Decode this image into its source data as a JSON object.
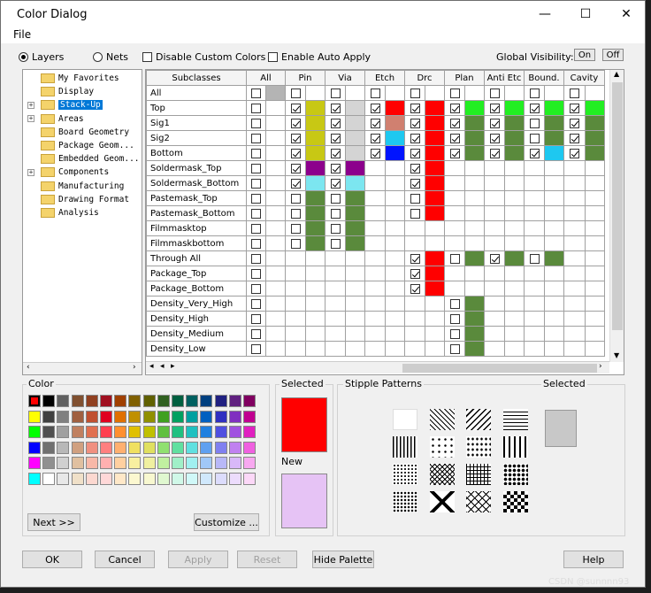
{
  "window": {
    "title": "Color Dialog",
    "minimize": "—",
    "maximize": "☐",
    "close": "✕"
  },
  "menu": {
    "file": "File"
  },
  "options": {
    "layers_label": "Layers",
    "nets_label": "Nets",
    "disable_custom_label": "Disable Custom Colors",
    "auto_apply_label": "Enable Auto Apply",
    "global_visibility_label": "Global Visibility:",
    "on_label": "On",
    "off_label": "Off"
  },
  "tree": {
    "items": [
      {
        "label": "My Favorites",
        "expander": false,
        "selected": false
      },
      {
        "label": "Display",
        "expander": false,
        "selected": false
      },
      {
        "label": "Stack-Up",
        "expander": true,
        "selected": true
      },
      {
        "label": "Areas",
        "expander": true,
        "selected": false
      },
      {
        "label": "Board Geometry",
        "expander": false,
        "selected": false
      },
      {
        "label": "Package Geom...",
        "expander": false,
        "selected": false
      },
      {
        "label": "Embedded Geom...",
        "expander": false,
        "selected": false
      },
      {
        "label": "Components",
        "expander": true,
        "selected": false
      },
      {
        "label": "Manufacturing",
        "expander": false,
        "selected": false
      },
      {
        "label": "Drawing Format",
        "expander": false,
        "selected": false
      },
      {
        "label": "Analysis",
        "expander": false,
        "selected": false
      }
    ]
  },
  "grid": {
    "name_header": "Subclasses",
    "columns": [
      "All",
      "Pin",
      "Via",
      "Etch",
      "Drc",
      "Plan",
      "Anti Etc",
      "Bound.",
      "Cavity"
    ],
    "rows": [
      {
        "name": "All",
        "cells": [
          [
            "c",
            "#b4b4b4"
          ],
          [
            "c",
            ""
          ],
          [
            "c",
            ""
          ],
          [
            "c",
            ""
          ],
          [
            "c",
            ""
          ],
          [
            "c",
            ""
          ],
          [
            "c",
            ""
          ],
          [
            "c",
            ""
          ],
          [
            "c",
            ""
          ]
        ]
      },
      {
        "name": "Top",
        "cells": [
          [
            "c",
            ""
          ],
          [
            "k",
            "#c8c814"
          ],
          [
            "k",
            "#d4d4d4"
          ],
          [
            "k",
            "#ff0000"
          ],
          [
            "k",
            "#ff0000"
          ],
          [
            "k",
            "#22ee22"
          ],
          [
            "k",
            "#22ee22"
          ],
          [
            "k",
            "#22ee22"
          ],
          [
            "k",
            "#22ee22"
          ]
        ]
      },
      {
        "name": "Sig1",
        "cells": [
          [
            "c",
            ""
          ],
          [
            "k",
            "#c8c814"
          ],
          [
            "k",
            "#d4d4d4"
          ],
          [
            "k",
            "#d08070"
          ],
          [
            "k",
            "#ff0000"
          ],
          [
            "k",
            "#5a8a3c"
          ],
          [
            "k",
            "#5a8a3c"
          ],
          [
            "c",
            "#5a8a3c"
          ],
          [
            "k",
            "#5a8a3c"
          ]
        ]
      },
      {
        "name": "Sig2",
        "cells": [
          [
            "c",
            ""
          ],
          [
            "k",
            "#c8c814"
          ],
          [
            "k",
            "#d4d4d4"
          ],
          [
            "k",
            "#1ec8f0"
          ],
          [
            "k",
            "#ff0000"
          ],
          [
            "k",
            "#5a8a3c"
          ],
          [
            "k",
            "#5a8a3c"
          ],
          [
            "c",
            "#5a8a3c"
          ],
          [
            "k",
            "#5a8a3c"
          ]
        ]
      },
      {
        "name": "Bottom",
        "cells": [
          [
            "c",
            ""
          ],
          [
            "k",
            "#c8c814"
          ],
          [
            "k",
            "#d4d4d4"
          ],
          [
            "k",
            "#0014ff"
          ],
          [
            "k",
            "#ff0000"
          ],
          [
            "k",
            "#5a8a3c"
          ],
          [
            "k",
            "#5a8a3c"
          ],
          [
            "k",
            "#1ec8f0"
          ],
          [
            "k",
            "#5a8a3c"
          ]
        ]
      },
      {
        "name": "Soldermask_Top",
        "cells": [
          [
            "c",
            ""
          ],
          [
            "k",
            "#8c008c"
          ],
          [
            "k",
            "#8c008c"
          ],
          [
            "-",
            ""
          ],
          [
            "k",
            "#ff0000"
          ],
          [
            "-",
            ""
          ],
          [
            "-",
            ""
          ],
          [
            "-",
            ""
          ],
          [
            "-",
            ""
          ]
        ]
      },
      {
        "name": "Soldermask_Bottom",
        "cells": [
          [
            "c",
            ""
          ],
          [
            "k",
            "#7ce6f0"
          ],
          [
            "k",
            "#7ce6f0"
          ],
          [
            "-",
            ""
          ],
          [
            "k",
            "#ff0000"
          ],
          [
            "-",
            ""
          ],
          [
            "-",
            ""
          ],
          [
            "-",
            ""
          ],
          [
            "-",
            ""
          ]
        ]
      },
      {
        "name": "Pastemask_Top",
        "cells": [
          [
            "c",
            ""
          ],
          [
            "c",
            "#5a8a3c"
          ],
          [
            "c",
            "#5a8a3c"
          ],
          [
            "-",
            ""
          ],
          [
            "c",
            "#ff0000"
          ],
          [
            "-",
            ""
          ],
          [
            "-",
            ""
          ],
          [
            "-",
            ""
          ],
          [
            "-",
            ""
          ]
        ]
      },
      {
        "name": "Pastemask_Bottom",
        "cells": [
          [
            "c",
            ""
          ],
          [
            "c",
            "#5a8a3c"
          ],
          [
            "c",
            "#5a8a3c"
          ],
          [
            "-",
            ""
          ],
          [
            "c",
            "#ff0000"
          ],
          [
            "-",
            ""
          ],
          [
            "-",
            ""
          ],
          [
            "-",
            ""
          ],
          [
            "-",
            ""
          ]
        ]
      },
      {
        "name": "Filmmasktop",
        "cells": [
          [
            "c",
            ""
          ],
          [
            "c",
            "#5a8a3c"
          ],
          [
            "c",
            "#5a8a3c"
          ],
          [
            "-",
            ""
          ],
          [
            "-",
            ""
          ],
          [
            "-",
            ""
          ],
          [
            "-",
            ""
          ],
          [
            "-",
            ""
          ],
          [
            "-",
            ""
          ]
        ]
      },
      {
        "name": "Filmmaskbottom",
        "cells": [
          [
            "c",
            ""
          ],
          [
            "c",
            "#5a8a3c"
          ],
          [
            "c",
            "#5a8a3c"
          ],
          [
            "-",
            ""
          ],
          [
            "-",
            ""
          ],
          [
            "-",
            ""
          ],
          [
            "-",
            ""
          ],
          [
            "-",
            ""
          ],
          [
            "-",
            ""
          ]
        ]
      },
      {
        "name": "Through All",
        "cells": [
          [
            "c",
            ""
          ],
          [
            "-",
            ""
          ],
          [
            "-",
            ""
          ],
          [
            "-",
            ""
          ],
          [
            "k",
            "#ff0000"
          ],
          [
            "c",
            "#5a8a3c"
          ],
          [
            "k",
            "#5a8a3c"
          ],
          [
            "c",
            "#5a8a3c"
          ],
          [
            "-",
            ""
          ]
        ]
      },
      {
        "name": "Package_Top",
        "cells": [
          [
            "c",
            ""
          ],
          [
            "-",
            ""
          ],
          [
            "-",
            ""
          ],
          [
            "-",
            ""
          ],
          [
            "k",
            "#ff0000"
          ],
          [
            "-",
            ""
          ],
          [
            "-",
            ""
          ],
          [
            "-",
            ""
          ],
          [
            "-",
            ""
          ]
        ]
      },
      {
        "name": "Package_Bottom",
        "cells": [
          [
            "c",
            ""
          ],
          [
            "-",
            ""
          ],
          [
            "-",
            ""
          ],
          [
            "-",
            ""
          ],
          [
            "k",
            "#ff0000"
          ],
          [
            "-",
            ""
          ],
          [
            "-",
            ""
          ],
          [
            "-",
            ""
          ],
          [
            "-",
            ""
          ]
        ]
      },
      {
        "name": "Density_Very_High",
        "cells": [
          [
            "c",
            ""
          ],
          [
            "-",
            ""
          ],
          [
            "-",
            ""
          ],
          [
            "-",
            ""
          ],
          [
            "-",
            ""
          ],
          [
            "c",
            "#5a8a3c"
          ],
          [
            "-",
            ""
          ],
          [
            "-",
            ""
          ],
          [
            "-",
            ""
          ]
        ]
      },
      {
        "name": "Density_High",
        "cells": [
          [
            "c",
            ""
          ],
          [
            "-",
            ""
          ],
          [
            "-",
            ""
          ],
          [
            "-",
            ""
          ],
          [
            "-",
            ""
          ],
          [
            "c",
            "#5a8a3c"
          ],
          [
            "-",
            ""
          ],
          [
            "-",
            ""
          ],
          [
            "-",
            ""
          ]
        ]
      },
      {
        "name": "Density_Medium",
        "cells": [
          [
            "c",
            ""
          ],
          [
            "-",
            ""
          ],
          [
            "-",
            ""
          ],
          [
            "-",
            ""
          ],
          [
            "-",
            ""
          ],
          [
            "c",
            "#5a8a3c"
          ],
          [
            "-",
            ""
          ],
          [
            "-",
            ""
          ],
          [
            "-",
            ""
          ]
        ]
      },
      {
        "name": "Density_Low",
        "cells": [
          [
            "c",
            ""
          ],
          [
            "-",
            ""
          ],
          [
            "-",
            ""
          ],
          [
            "-",
            ""
          ],
          [
            "-",
            ""
          ],
          [
            "c",
            "#5a8a3c"
          ],
          [
            "-",
            ""
          ],
          [
            "-",
            ""
          ],
          [
            "-",
            ""
          ]
        ]
      }
    ]
  },
  "color_panel": {
    "label": "Color",
    "selected_label": "Selected",
    "new_label": "New",
    "selected_color": "#ff0000",
    "new_color": "#e6c3f5",
    "next_label": "Next >>",
    "customize_label": "Customize ...",
    "palette": [
      [
        "#ff0000",
        "#000000",
        "#606060",
        "#805030",
        "#904020",
        "#a01020",
        "#a04000",
        "#806000",
        "#606000",
        "#306020",
        "#006040",
        "#006060",
        "#004080",
        "#202080",
        "#602080",
        "#800060"
      ],
      [
        "#ffff00",
        "#404040",
        "#808080",
        "#a06040",
        "#c05030",
        "#e00020",
        "#e07000",
        "#c09000",
        "#909000",
        "#40a020",
        "#00a060",
        "#00a0a0",
        "#0060c0",
        "#3030c0",
        "#8030c0",
        "#c00090"
      ],
      [
        "#00ff00",
        "#505050",
        "#a0a0a0",
        "#c08060",
        "#e07050",
        "#ff4050",
        "#ff9030",
        "#e0c000",
        "#c0c000",
        "#60c040",
        "#20c080",
        "#20c0c0",
        "#2080e0",
        "#5050e0",
        "#a050e0",
        "#e020c0"
      ],
      [
        "#0000ff",
        "#707070",
        "#b8b8b8",
        "#d0a080",
        "#f09080",
        "#ff8080",
        "#ffb070",
        "#f0e060",
        "#e0e060",
        "#90e070",
        "#60e0a0",
        "#60e0e0",
        "#60a0f0",
        "#8080f0",
        "#c080f0",
        "#f060e0"
      ],
      [
        "#ff00ff",
        "#909090",
        "#d0d0d0",
        "#e0c0a0",
        "#f8b8a8",
        "#ffb0b0",
        "#ffd0a0",
        "#f8f0a0",
        "#f0f0a0",
        "#c0f0a0",
        "#a0f0c8",
        "#a0f0f0",
        "#a0c8f8",
        "#b8b8f8",
        "#d8b8f8",
        "#f8a8f0"
      ],
      [
        "#00ffff",
        "#ffffff",
        "#e8e8e8",
        "#f0e0c8",
        "#fcd8d0",
        "#ffd8d8",
        "#ffe8c8",
        "#fcf8d0",
        "#f8f8d0",
        "#e0f8d0",
        "#d0f8e8",
        "#d0f8f8",
        "#d0e8fc",
        "#dcdcfc",
        "#ecdcfc",
        "#fcd8f8"
      ]
    ]
  },
  "stipple_panel": {
    "label": "Stipple Patterns",
    "selected_label": "Selected",
    "selected_fill": "#c8c8c8"
  },
  "footer": {
    "ok": "OK",
    "cancel": "Cancel",
    "apply": "Apply",
    "reset": "Reset",
    "hide_palette": "Hide Palette",
    "help": "Help"
  },
  "watermark": "CSDN @sunnnn93"
}
